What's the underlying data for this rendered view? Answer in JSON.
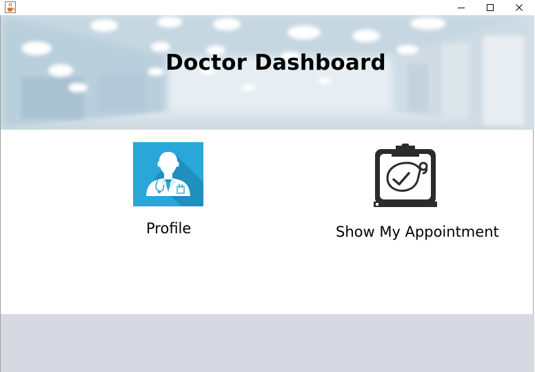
{
  "window": {
    "app_icon": "java-cup-icon",
    "controls": [
      {
        "name": "minimize-icon",
        "glyph": "–"
      },
      {
        "name": "maximize-icon",
        "glyph": "☐"
      },
      {
        "name": "close-icon",
        "glyph": "✕"
      }
    ]
  },
  "header": {
    "title": "Doctor Dashboard",
    "background": "blurred-hospital-corridor-photo"
  },
  "menu": {
    "profile": {
      "label": "Profile",
      "icon": "doctor-avatar-icon",
      "accent": "#2aa7d8"
    },
    "appointments": {
      "label": "Show My Appointment",
      "icon": "clipboard-stethoscope-icon",
      "accent": "#2b2b2b"
    }
  },
  "colors": {
    "footer": "#d6d9e1",
    "banner_tint": "#cfe0ea"
  }
}
